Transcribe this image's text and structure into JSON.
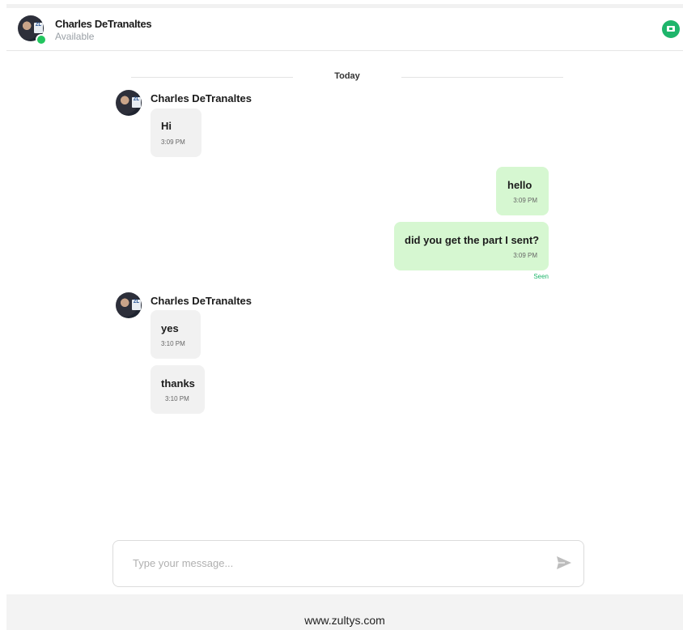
{
  "header": {
    "contact_name": "Charles DeTranaltes",
    "status": "Available",
    "video_icon": "video-call-icon"
  },
  "date_divider": "Today",
  "messages": [
    {
      "direction": "in",
      "sender": "Charles DeTranaltes",
      "text": "Hi",
      "time": "3:09 PM"
    },
    {
      "direction": "out",
      "text": "hello",
      "time": "3:09 PM"
    },
    {
      "direction": "out",
      "text": "did you get the part I sent?",
      "time": "3:09 PM",
      "receipt": "Seen"
    },
    {
      "direction": "in",
      "sender": "Charles DeTranaltes",
      "text": "yes",
      "time": "3:10 PM"
    },
    {
      "direction": "in",
      "text": "thanks",
      "time": "3:10 PM"
    }
  ],
  "composer": {
    "placeholder": "Type your message...",
    "value": "",
    "send_icon": "send-icon"
  },
  "footer": {
    "text": "www.zultys.com"
  },
  "colors": {
    "accent": "#1eb56b",
    "outgoing_bubble": "#d6f7d1",
    "incoming_bubble": "#f1f1f1",
    "presence": "#22c55e"
  }
}
